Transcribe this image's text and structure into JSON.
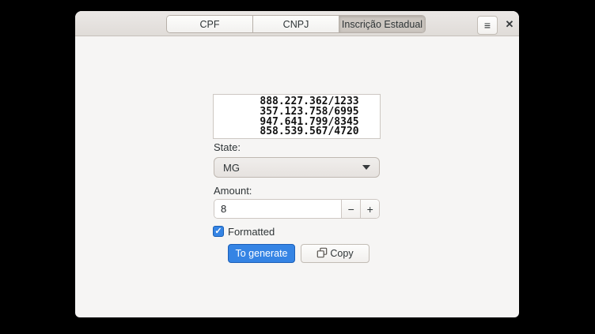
{
  "app": {
    "accent_color": "#3584e4",
    "window_bg": "#f6f5f4",
    "headerbar_bg": "#e8e5e2"
  },
  "header": {
    "tabs": [
      {
        "label": "CPF",
        "active": false
      },
      {
        "label": "CNPJ",
        "active": false
      },
      {
        "label": "Inscrição Estadual",
        "active": true
      }
    ],
    "active_tab": "Inscrição Estadual"
  },
  "icons": {
    "menu": "≡",
    "close": "✕",
    "check": "✓"
  },
  "results": {
    "items": [
      "888.227.362/1233",
      "357.123.758/6995",
      "947.641.799/8345",
      "858.539.567/4720"
    ]
  },
  "state": {
    "label": "State:",
    "value": "MG"
  },
  "amount": {
    "label": "Amount:",
    "value": "8",
    "decrement": "−",
    "increment": "+"
  },
  "formatted": {
    "label": "Formatted",
    "checked": true
  },
  "actions": {
    "generate": "To generate",
    "copy": "Copy"
  }
}
